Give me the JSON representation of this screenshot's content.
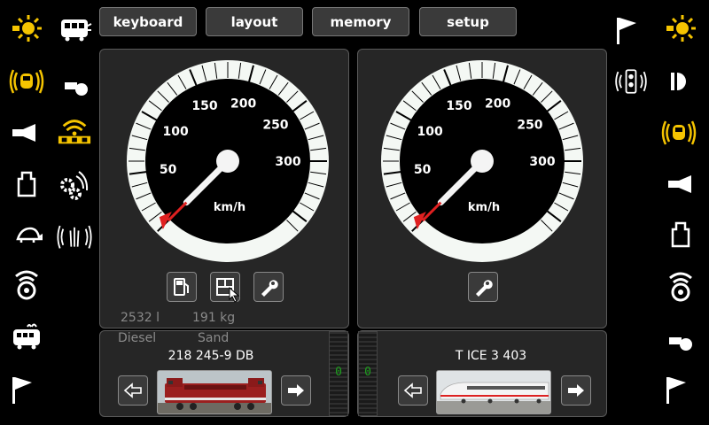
{
  "topbar": {
    "keyboard": "keyboard",
    "layout": "layout",
    "memory": "memory",
    "setup": "setup"
  },
  "left_panel": {
    "gauge": {
      "unit": "km/h",
      "ticks": [
        "50",
        "100",
        "150",
        "200",
        "250",
        "300"
      ],
      "speed": 0
    },
    "fuel": {
      "value": "2532 l",
      "label": "Diesel"
    },
    "sand": {
      "value": "191 kg",
      "label": "Sand"
    },
    "loco_name": "218 245-9 DB",
    "meter_value": "0"
  },
  "right_panel": {
    "gauge": {
      "unit": "km/h",
      "ticks": [
        "50",
        "100",
        "150",
        "200",
        "250",
        "300"
      ],
      "speed": 0
    },
    "loco_name": "T ICE 3 403",
    "meter_value": "0"
  },
  "colors": {
    "active_icon": "#f5c400",
    "inactive_icon": "#ffffff",
    "needle_mark": "#e02020",
    "meter_digit": "#1ea01e"
  }
}
